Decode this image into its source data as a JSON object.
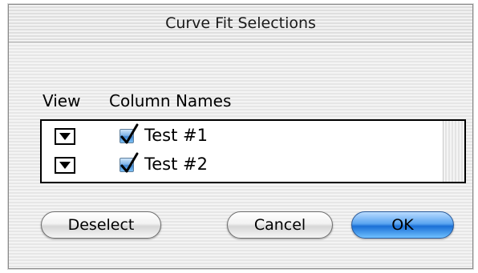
{
  "window": {
    "title": "Curve Fit Selections"
  },
  "columns_header": {
    "view_label": "View",
    "names_label": "Column Names"
  },
  "rows": [
    {
      "name": "Test #1",
      "checked": true,
      "view_icon": "triangle-down-icon"
    },
    {
      "name": "Test #2",
      "checked": true,
      "view_icon": "triangle-down-icon"
    }
  ],
  "buttons": {
    "deselect_label": "Deselect",
    "cancel_label": "Cancel",
    "ok_label": "OK"
  },
  "colors": {
    "default_button": "#1a6fd6",
    "checkbox_fill": "#3f86d2",
    "checkmark": "#000000"
  }
}
